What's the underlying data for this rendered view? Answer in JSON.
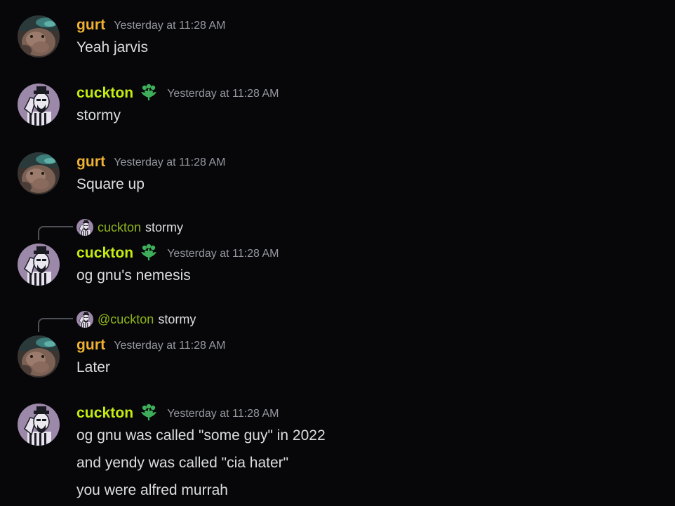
{
  "colors": {
    "background": "#070709",
    "gurt_name": "#f0b232",
    "cuckton_name": "#c3ec10",
    "reply_name": "#8db51a",
    "timestamp": "#9597a0",
    "role_icon": "#3fae5a"
  },
  "icons": {
    "role": "flower-heart-role-icon"
  },
  "messages": [
    {
      "author": "gurt",
      "timestamp": "Yesterday at 11:28 AM",
      "lines": [
        "Yeah jarvis"
      ]
    },
    {
      "author": "cuckton",
      "timestamp": "Yesterday at 11:28 AM",
      "lines": [
        "stormy"
      ]
    },
    {
      "author": "gurt",
      "timestamp": "Yesterday at 11:28 AM",
      "lines": [
        "Square up"
      ]
    },
    {
      "author": "cuckton",
      "timestamp": "Yesterday at 11:28 AM",
      "reply": {
        "name": "cuckton",
        "text": "stormy"
      },
      "lines": [
        "og gnu's nemesis"
      ]
    },
    {
      "author": "gurt",
      "timestamp": "Yesterday at 11:28 AM",
      "reply": {
        "name": "@cuckton",
        "text": "stormy"
      },
      "lines": [
        "Later"
      ]
    },
    {
      "author": "cuckton",
      "timestamp": "Yesterday at 11:28 AM",
      "lines": [
        "og gnu was called \"some guy\" in 2022",
        "and yendy was called \"cia hater\"",
        "you were alfred murrah"
      ]
    }
  ]
}
